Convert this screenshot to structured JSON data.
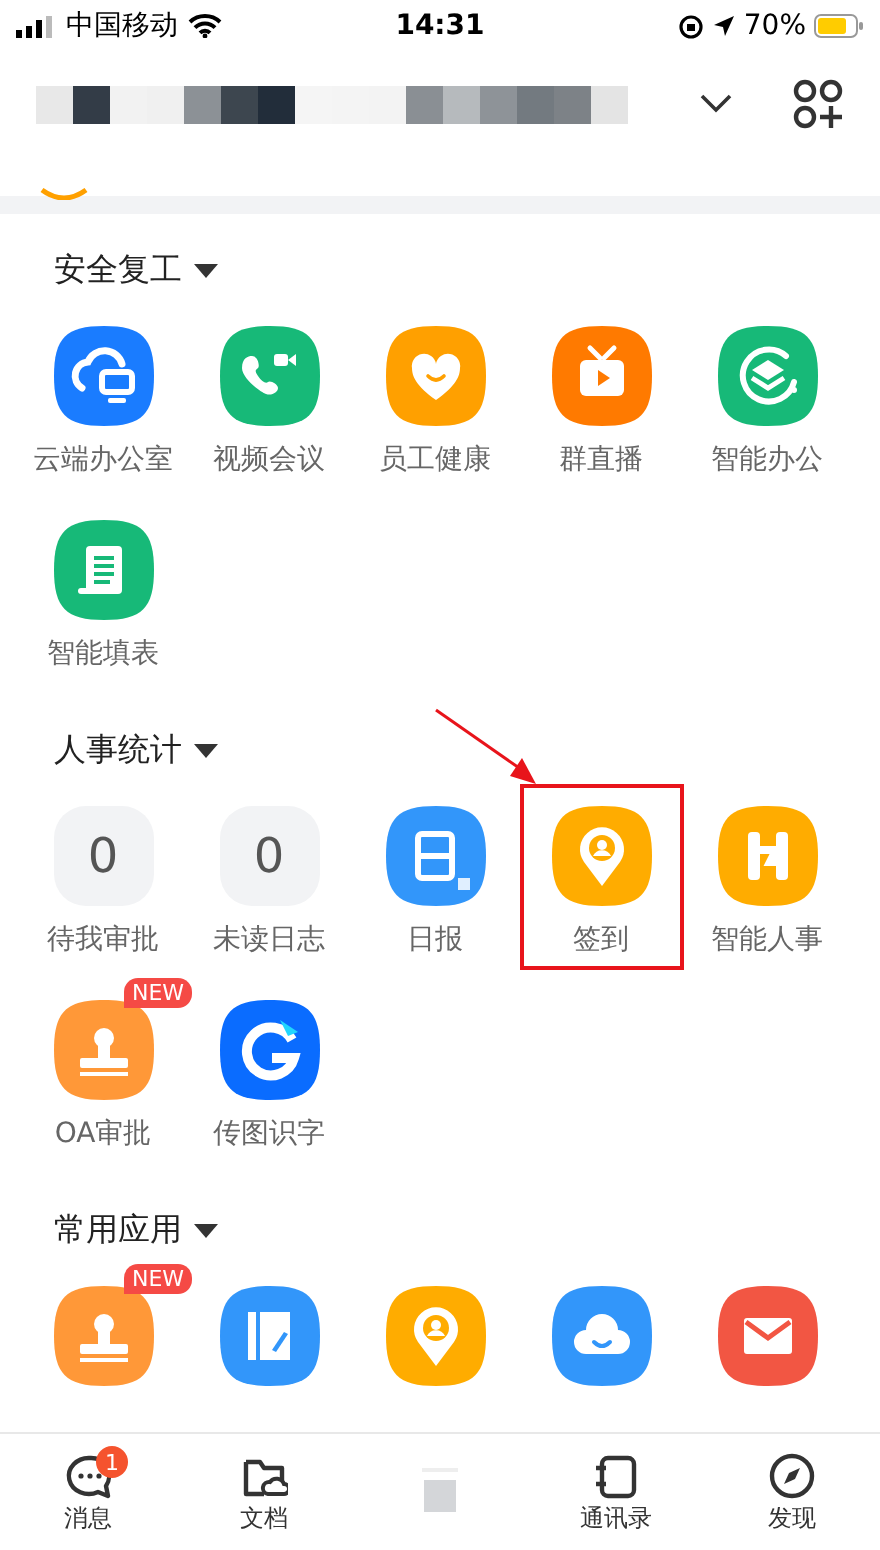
{
  "status_bar": {
    "carrier": "中国移动",
    "time": "14:31",
    "battery": "70%"
  },
  "sections": [
    {
      "title": "安全复工",
      "items": [
        {
          "kind": "app",
          "label": "云端办公室",
          "highlighted": false
        },
        {
          "kind": "app",
          "label": "视频会议",
          "highlighted": false
        },
        {
          "kind": "app",
          "label": "员工健康",
          "highlighted": false
        },
        {
          "kind": "app",
          "label": "群直播",
          "highlighted": false
        },
        {
          "kind": "app",
          "label": "智能办公",
          "highlighted": false
        },
        {
          "kind": "app",
          "label": "智能填表",
          "highlighted": false
        }
      ]
    },
    {
      "title": "人事统计",
      "items": [
        {
          "kind": "counter",
          "label": "待我审批",
          "count": "0",
          "highlighted": false
        },
        {
          "kind": "counter",
          "label": "未读日志",
          "count": "0",
          "highlighted": false
        },
        {
          "kind": "app",
          "label": "日报",
          "highlighted": false
        },
        {
          "kind": "app",
          "label": "签到",
          "highlighted": true
        },
        {
          "kind": "app",
          "label": "智能人事",
          "highlighted": false
        },
        {
          "kind": "app",
          "label": "OA审批",
          "badge": "NEW",
          "highlighted": false
        },
        {
          "kind": "app",
          "label": "传图识字",
          "highlighted": false
        }
      ]
    },
    {
      "title": "常用应用",
      "items": [
        {
          "kind": "app",
          "badge": "NEW",
          "highlighted": false
        },
        {
          "kind": "app",
          "highlighted": false
        },
        {
          "kind": "app",
          "highlighted": false
        },
        {
          "kind": "app",
          "highlighted": false
        },
        {
          "kind": "app",
          "highlighted": false
        }
      ]
    }
  ],
  "tab_bar": [
    {
      "kind": "tab",
      "label": "消息",
      "badge": "1"
    },
    {
      "kind": "tab",
      "label": "文档"
    },
    {
      "kind": "blurred"
    },
    {
      "kind": "tab",
      "label": "通讯录"
    },
    {
      "kind": "tab",
      "label": "发现"
    }
  ]
}
